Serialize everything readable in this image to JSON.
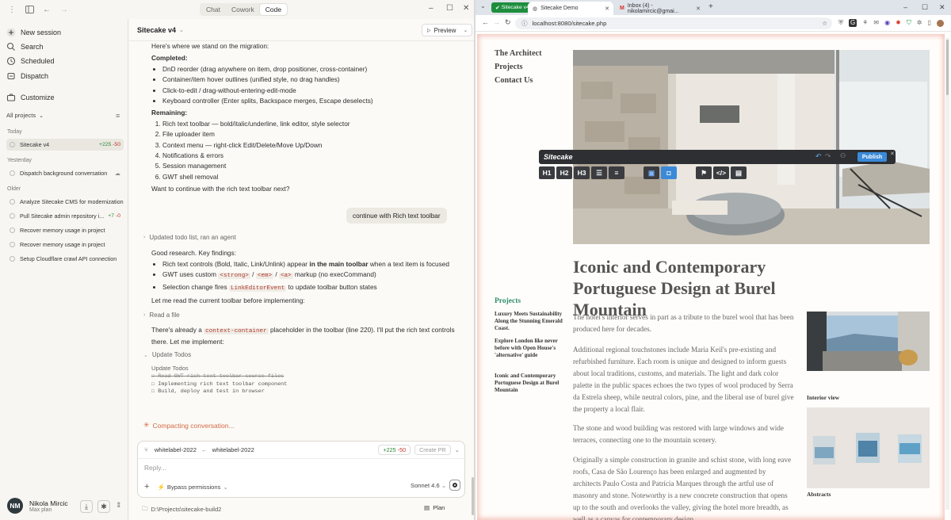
{
  "app": {
    "modes": [
      "Chat",
      "Cowork",
      "Code"
    ],
    "active_mode": "Code",
    "sidebar": {
      "new_session": "New session",
      "search": "Search",
      "scheduled": "Scheduled",
      "dispatch": "Dispatch",
      "customize": "Customize",
      "filter": "All projects",
      "sections": {
        "today": "Today",
        "yesterday": "Yesterday",
        "older": "Older"
      },
      "today": [
        {
          "title": "Sitecake v4",
          "added": "+225",
          "removed": "-50"
        }
      ],
      "yesterday": [
        {
          "title": "Dispatch background conversation"
        }
      ],
      "older": [
        {
          "title": "Analyze Sitecake CMS for modernization"
        },
        {
          "title": "Pull Sitecake admin repository i...",
          "added": "+7",
          "removed": "-0"
        },
        {
          "title": "Recover memory usage in project"
        },
        {
          "title": "Recover memory usage in project"
        },
        {
          "title": "Setup Cloudflare crawl API connection"
        }
      ]
    },
    "user": {
      "initials": "NM",
      "name": "Nikola Mircic",
      "plan": "Max plan"
    },
    "main": {
      "session_title": "Sitecake v4",
      "preview_label": "Preview",
      "intro": "Here's where we stand on the migration:",
      "completed_label": "Completed:",
      "completed": [
        "DnD reorder (drag anywhere on item, drop positioner, cross-container)",
        "Container/item hover outlines (unified style, no drag handles)",
        "Click-to-edit / drag-without-entering-edit-mode",
        "Keyboard controller (Enter splits, Backspace merges, Escape deselects)"
      ],
      "remaining_label": "Remaining:",
      "remaining": [
        "Rich text toolbar — bold/italic/underline, link editor, style selector",
        "File uploader item",
        "Context menu — right-click Edit/Delete/Move Up/Down",
        "Notifications & errors",
        "Session management",
        "GWT shell removal"
      ],
      "question": "Want to continue with the rich text toolbar next?",
      "user_message": "continue with Rich text toolbar",
      "tool1": "Updated todo list, ran an agent",
      "findings_intro": "Good research. Key findings:",
      "finding1_a": "Rich text controls (Bold, Italic, Link/Unlink) appear ",
      "finding1_b": "in the main toolbar",
      "finding1_c": " when a text item is focused",
      "finding2_a": "GWT uses custom ",
      "finding2_code1": "<strong>",
      "finding2_sep1": " / ",
      "finding2_code2": "<em>",
      "finding2_sep2": " / ",
      "finding2_code3": "<a>",
      "finding2_b": " markup (no execCommand)",
      "finding3_a": "Selection change fires ",
      "finding3_code": "LinkEditorEvent",
      "finding3_b": " to update toolbar button states",
      "read_toolbar": "Let me read the current toolbar before implementing:",
      "tool2": "Read a file",
      "context_a": "There's already a ",
      "context_code": "context-container",
      "context_b": " placeholder in the toolbar (line 220). I'll put the rich text controls there. Let me implement:",
      "tool3": "Update Todos",
      "todos_label": "Update Todos",
      "todos": [
        {
          "text": "Read GWT rich text toolbar source files",
          "done": true
        },
        {
          "text": "Implementing rich text toolbar component",
          "done": false
        },
        {
          "text": "Build, deploy and test in browser",
          "done": false
        }
      ],
      "compacting": "Compacting conversation..."
    },
    "composer": {
      "branch_from": "whitelabel-2022",
      "branch_to": "whitelabel-2022",
      "added": "+225",
      "removed": "-50",
      "create_pr": "Create PR",
      "placeholder": "Reply...",
      "permissions": "Bypass permissions",
      "model": "Sonnet 4.6",
      "path": "D:\\Projects\\sitecake-build2",
      "plan": "Plan"
    }
  },
  "browser": {
    "tabs": [
      {
        "title": "Sitecake v4"
      },
      {
        "title": "Sitecake Demo",
        "active": true
      },
      {
        "title": "Inbox (4) - nikolamircic@gmai..."
      }
    ],
    "url": "localhost:8080/sitecake.php",
    "page": {
      "nav": [
        "The Architect",
        "Projects",
        "Contact Us"
      ],
      "editor_brand": "Sitecake",
      "publish": "Publish",
      "format_buttons": [
        "H1",
        "H2",
        "H3"
      ],
      "title": "Iconic and Contemporary Portuguese Design at Burel Mountain",
      "paragraphs": [
        "The hotel's interior serves in part as a tribute to the burel wool that has been produced here for decades.",
        "Additional regional touchstones include Maria Keil's pre-existing and refurbished furniture. Each room is unique and designed to inform guests about local traditions, customs, and materials. The light and dark color palette in the public spaces echoes the two types of wool produced by Serra da Estrela sheep, while neutral colors, pine, and the liberal use of burel give the property a local flair.",
        "The stone and wood building was restored with large windows and wide terraces, connecting one to the mountain scenery.",
        "Originally a simple construction in granite and schist stone, with long eave roofs, Casa de São Lourenço has been enlarged and augmented by architects Paulo Costa and Patrícia Marques through the artful use of masonry and stone. Noteworthy is a new concrete construction that opens up to the south and overlooks the valley, giving the hotel more breadth, as well as a canvas for contemporary design."
      ],
      "side_heading": "Projects",
      "side_links": [
        "Luxury Meets Sustainability Along the Stunning Emerald Coast.",
        "Explore London like never before with Open House's 'alternative' guide",
        "Iconic and Contemporary Portuguese Design at Burel Mountain"
      ],
      "captions": [
        "Interior view",
        "Abstracts"
      ]
    }
  }
}
